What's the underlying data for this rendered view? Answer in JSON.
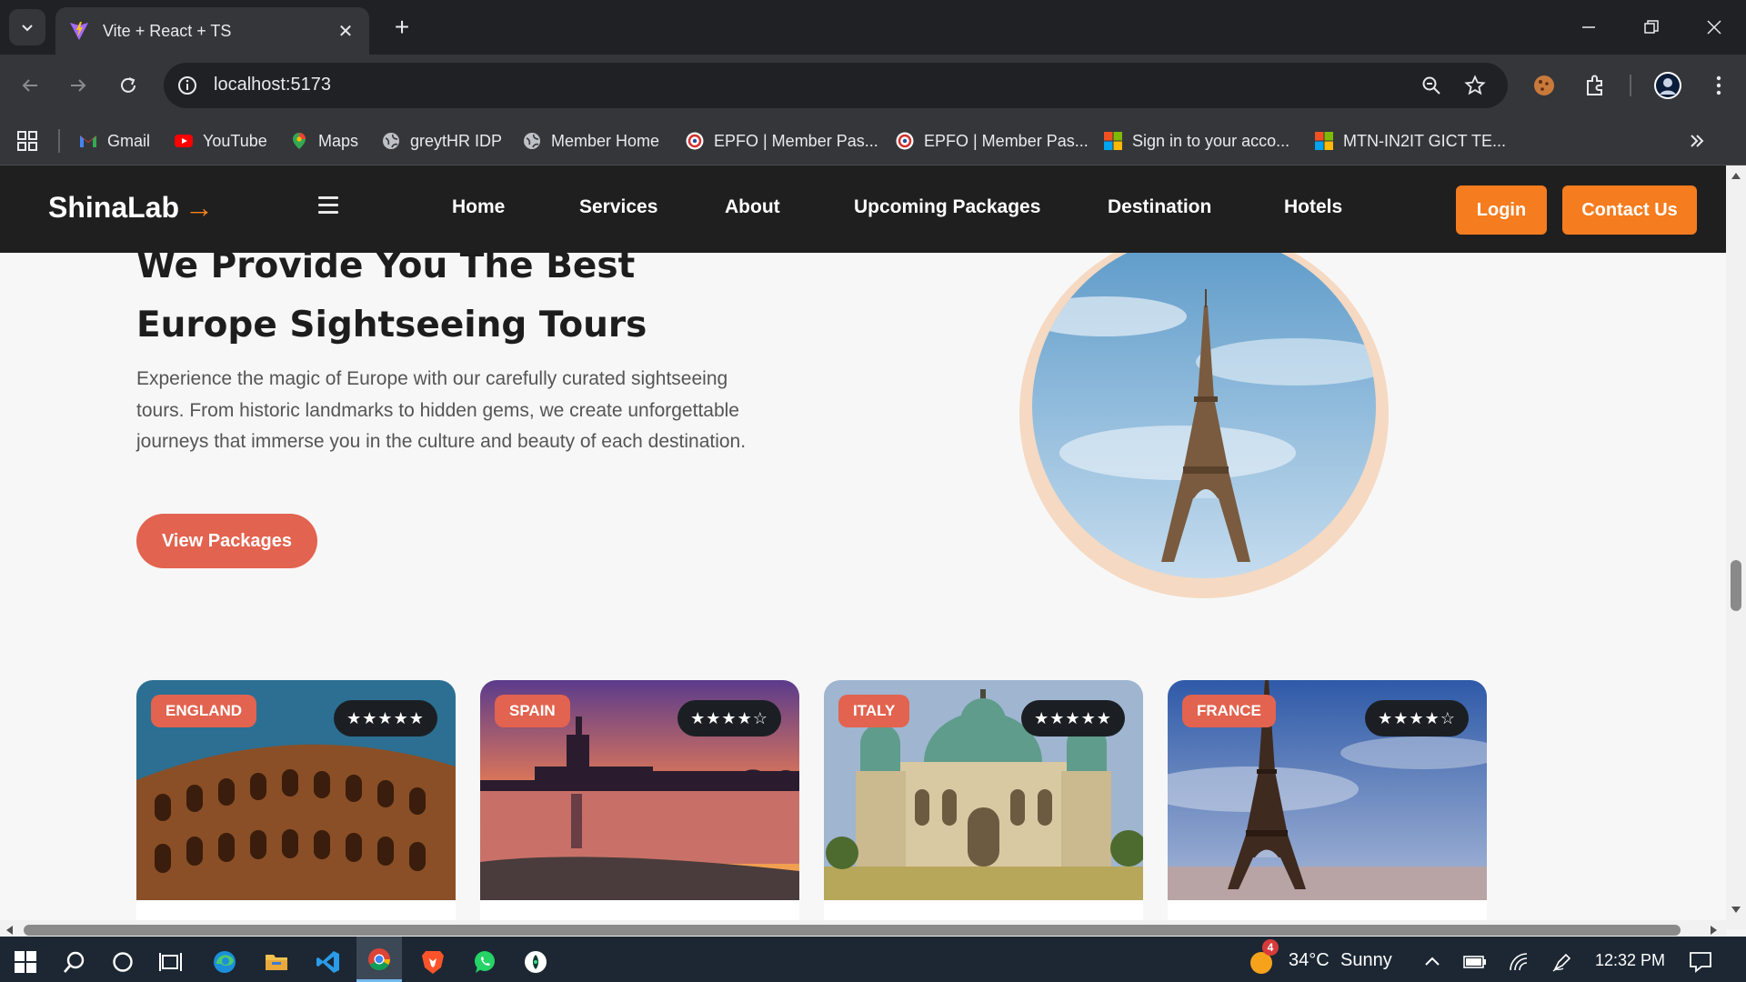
{
  "browser": {
    "tab_title": "Vite + React + TS",
    "url": "localhost:5173",
    "bookmarks": [
      {
        "label": "Gmail",
        "icon": "gmail-icon"
      },
      {
        "label": "YouTube",
        "icon": "youtube-icon"
      },
      {
        "label": "Maps",
        "icon": "maps-icon"
      },
      {
        "label": "greytHR IDP",
        "icon": "globe-icon"
      },
      {
        "label": "Member Home",
        "icon": "globe-icon"
      },
      {
        "label": "EPFO | Member Pas...",
        "icon": "epfo-icon"
      },
      {
        "label": "EPFO | Member Pas...",
        "icon": "epfo-icon"
      },
      {
        "label": "Sign in to your acco...",
        "icon": "microsoft-icon"
      },
      {
        "label": "MTN-IN2IT GICT TE...",
        "icon": "microsoft-icon"
      }
    ]
  },
  "site": {
    "logo": "ShinaLab",
    "logo_arrow": "→",
    "nav": [
      "Home",
      "Services",
      "About",
      "Upcoming Packages",
      "Destination",
      "Hotels"
    ],
    "login_label": "Login",
    "contact_label": "Contact Us",
    "accent_color": "#f57c1f"
  },
  "hero": {
    "title": "We Provide You The Best Europe Sightseeing Tours",
    "description": "Experience the magic of Europe with our carefully curated sightseeing tours. From historic landmarks to hidden gems, we create unforgettable journeys that immerse you in the culture and beauty of each destination.",
    "button_label": "View Packages"
  },
  "cards": [
    {
      "country": "ENGLAND",
      "rating": "★★★★★"
    },
    {
      "country": "SPAIN",
      "rating": "★★★★☆"
    },
    {
      "country": "ITALY",
      "rating": "★★★★★"
    },
    {
      "country": "FRANCE",
      "rating": "★★★★☆"
    }
  ],
  "taskbar": {
    "temperature": "34°C",
    "weather": "Sunny",
    "weather_badge": "4",
    "time": "12:32 PM"
  }
}
